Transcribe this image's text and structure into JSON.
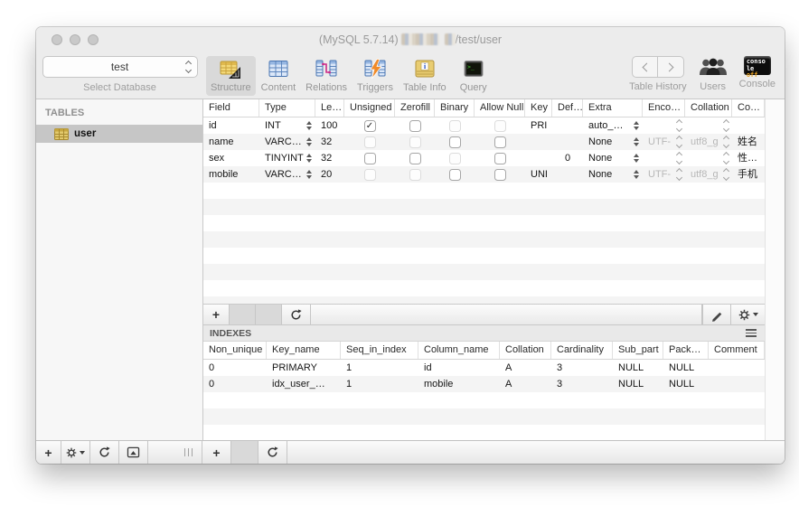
{
  "window": {
    "title_prefix": "(MySQL 5.7.14)",
    "title_suffix": "/test/user"
  },
  "toolbar": {
    "database_select": {
      "value": "test",
      "caption": "Select Database"
    },
    "items": [
      {
        "label": "Structure",
        "icon": "structure-icon",
        "active": true
      },
      {
        "label": "Content",
        "icon": "content-icon",
        "active": false
      },
      {
        "label": "Relations",
        "icon": "relations-icon",
        "active": false
      },
      {
        "label": "Triggers",
        "icon": "triggers-icon",
        "active": false
      },
      {
        "label": "Table Info",
        "icon": "table-info-icon",
        "active": false
      },
      {
        "label": "Query",
        "icon": "query-icon",
        "active": false
      }
    ],
    "table_history_label": "Table History",
    "users_label": "Users",
    "console_label": "Console",
    "console_badge": {
      "line1": "conso",
      "line2_white": "le ",
      "line2_accent": "off"
    }
  },
  "sidebar": {
    "section_title": "TABLES",
    "tables": [
      {
        "name": "user",
        "selected": true
      }
    ]
  },
  "structure": {
    "columns": [
      "Field",
      "Type",
      "Le…",
      "Unsigned",
      "Zerofill",
      "Binary",
      "Allow Null",
      "Key",
      "Def…",
      "Extra",
      "Enco…",
      "Collation",
      "Co…"
    ],
    "rows": [
      {
        "field": "id",
        "type": "INT",
        "length": "100",
        "unsigned": "checked",
        "zerofill": "unchecked",
        "binary": "disabled",
        "allow_null": "disabled",
        "key": "PRI",
        "default": "",
        "extra": "auto_…",
        "encoding": "",
        "collation": "",
        "comment": ""
      },
      {
        "field": "name",
        "type": "VARC…",
        "length": "32",
        "unsigned": "disabled",
        "zerofill": "disabled",
        "binary": "unchecked",
        "allow_null": "unchecked",
        "key": "",
        "default": "",
        "extra": "None",
        "encoding": "UTF-",
        "collation": "utf8_g",
        "comment": "姓名"
      },
      {
        "field": "sex",
        "type": "TINYINT",
        "length": "32",
        "unsigned": "unchecked",
        "zerofill": "unchecked",
        "binary": "disabled",
        "allow_null": "unchecked",
        "key": "",
        "default": "0",
        "extra": "None",
        "encoding": "",
        "collation": "",
        "comment": "性…"
      },
      {
        "field": "mobile",
        "type": "VARC…",
        "length": "20",
        "unsigned": "disabled",
        "zerofill": "disabled",
        "binary": "unchecked",
        "allow_null": "unchecked",
        "key": "UNI",
        "default": "",
        "extra": "None",
        "encoding": "UTF-",
        "collation": "utf8_g",
        "comment": "手机"
      }
    ]
  },
  "indexes": {
    "title": "INDEXES",
    "columns": [
      "Non_unique",
      "Key_name",
      "Seq_in_index",
      "Column_name",
      "Collation",
      "Cardinality",
      "Sub_part",
      "Pack…",
      "Comment"
    ],
    "rows": [
      {
        "non_unique": "0",
        "key_name": "PRIMARY",
        "seq_in_index": "1",
        "column_name": "id",
        "collation": "A",
        "cardinality": "3",
        "sub_part": "NULL",
        "packed": "NULL",
        "comment": ""
      },
      {
        "non_unique": "0",
        "key_name": "idx_user_…",
        "seq_in_index": "1",
        "column_name": "mobile",
        "collation": "A",
        "cardinality": "3",
        "sub_part": "NULL",
        "packed": "NULL",
        "comment": ""
      }
    ]
  },
  "actions": {
    "add_label": "+"
  },
  "colors": {
    "chrome_gray": "#ececec",
    "selected_item": "#d9d9d9",
    "selection_row": "#c6c6c6",
    "alt_row": "#f4f4f4",
    "dim_text": "#b7b7b7",
    "table_gold": "#e0b94e",
    "table_blue": "#4a76b2",
    "relation_pink": "#cc2a88",
    "trigger_orange": "#f08a28",
    "terminal_green": "#46c832",
    "console_off_orange": "#e8a020"
  }
}
